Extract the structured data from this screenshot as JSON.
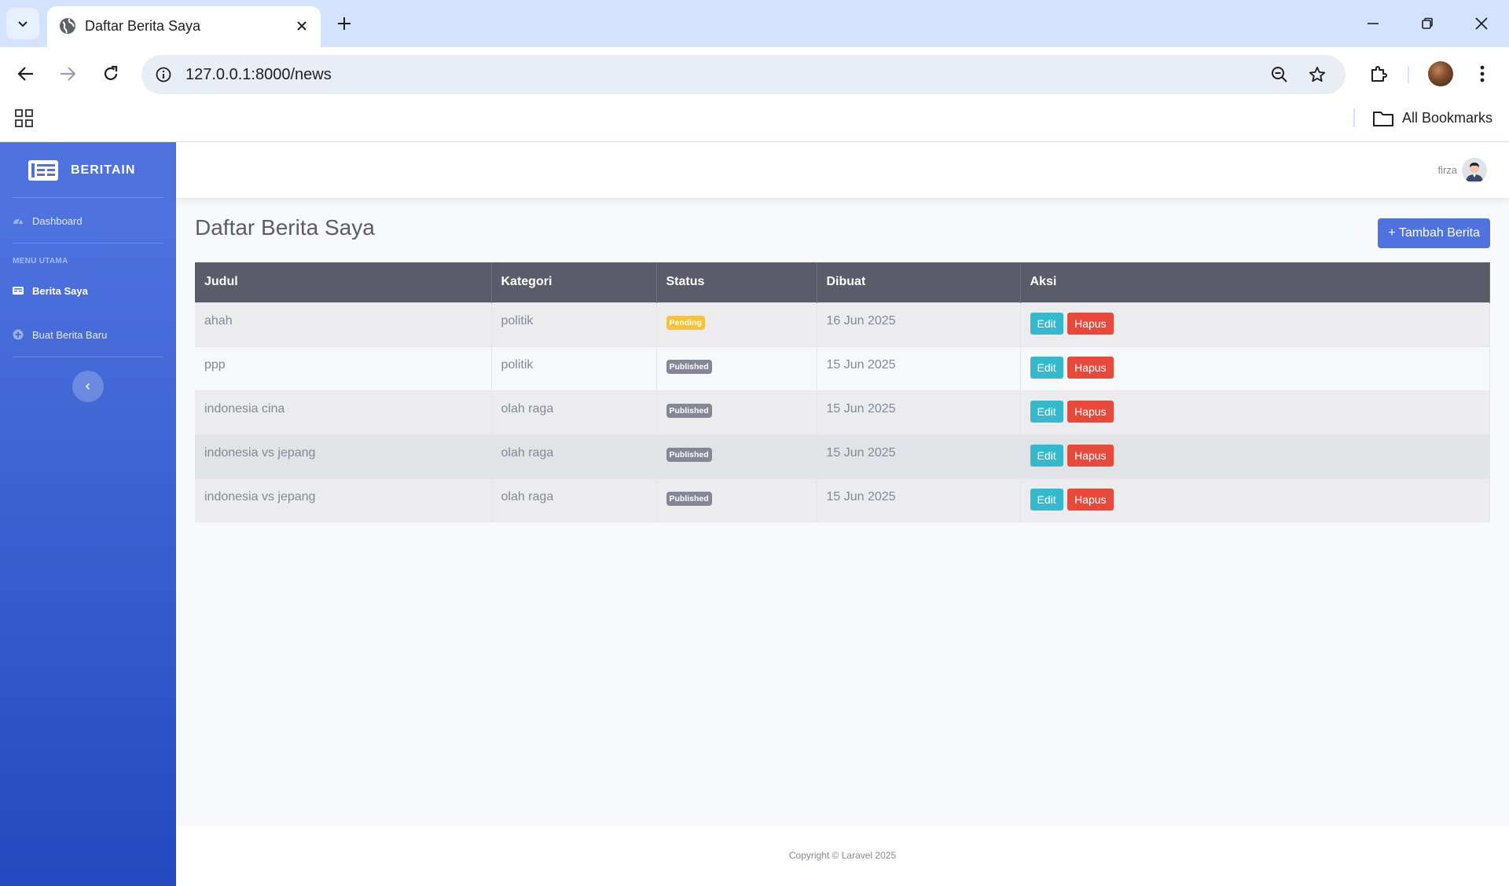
{
  "browser": {
    "tab_title": "Daftar Berita Saya",
    "url": "127.0.0.1:8000/news",
    "bookmarks_label": "All Bookmarks"
  },
  "sidebar": {
    "brand": "BERITAIN",
    "dashboard_label": "Dashboard",
    "heading": "MENU UTAMA",
    "items": [
      {
        "label": "Berita Saya",
        "icon": "newspaper-icon",
        "active": true
      },
      {
        "label": "Buat Berita Baru",
        "icon": "plus-circle-icon",
        "active": false
      }
    ]
  },
  "topbar": {
    "user_name": "firza"
  },
  "main": {
    "title": "Daftar Berita Saya",
    "add_button": "+ Tambah Berita",
    "table": {
      "headers": [
        "Judul",
        "Kategori",
        "Status",
        "Dibuat",
        "Aksi"
      ],
      "rows": [
        {
          "judul": "ahah",
          "kategori": "politik",
          "status": "Pending",
          "dibuat": "16 Jun 2025"
        },
        {
          "judul": "ppp",
          "kategori": "politik",
          "status": "Published",
          "dibuat": "15 Jun 2025"
        },
        {
          "judul": "indonesia cina",
          "kategori": "olah raga",
          "status": "Published",
          "dibuat": "15 Jun 2025"
        },
        {
          "judul": "indonesia vs jepang",
          "kategori": "olah raga",
          "status": "Published",
          "dibuat": "15 Jun 2025"
        },
        {
          "judul": "indonesia vs jepang",
          "kategori": "olah raga",
          "status": "Published",
          "dibuat": "15 Jun 2025"
        }
      ],
      "edit_label": "Edit",
      "delete_label": "Hapus"
    }
  },
  "footer": {
    "text": "Copyright © Laravel 2025"
  },
  "colors": {
    "primary": "#4e73df",
    "info": "#36b9cc",
    "danger": "#e74a3b",
    "warning": "#f6c23e",
    "secondary": "#858796"
  }
}
